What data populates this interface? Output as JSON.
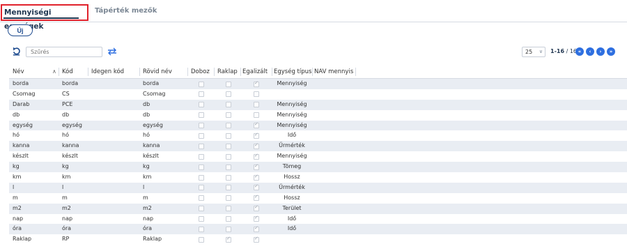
{
  "tabs": [
    {
      "label": "Mennyiségi egységek",
      "active": true
    },
    {
      "label": "Tápérték mezők",
      "active": false
    }
  ],
  "new_button": "Új",
  "filter": {
    "placeholder": "Szűrés",
    "value": "Szűrés"
  },
  "pagination": {
    "page_size": "25",
    "range": "1-16",
    "total": " / 16"
  },
  "icons": {
    "refresh": "refresh-icon",
    "swap": "swap-columns-icon",
    "first": "first-page-icon",
    "prev": "prev-page-icon",
    "next": "next-page-icon",
    "last": "last-page-icon"
  },
  "colors": {
    "accent": "#2e6fe0",
    "tab_highlight": "#e0212b",
    "row_stripe": "#e9edf3"
  },
  "columns": [
    "Név",
    "Kód",
    "Idegen kód",
    "Rövid név",
    "Doboz",
    "Raklap",
    "Egalizált",
    "Egység típus",
    "NAV mennyis"
  ],
  "rows": [
    {
      "nev": "borda",
      "kod": "borda",
      "idegen": "",
      "rovid": "borda",
      "doboz": false,
      "raklap": false,
      "egal": true,
      "tipus": "Mennyiség"
    },
    {
      "nev": "Csomag",
      "kod": "CS",
      "idegen": "",
      "rovid": "Csomag",
      "doboz": false,
      "raklap": false,
      "egal": false,
      "tipus": ""
    },
    {
      "nev": "Darab",
      "kod": "PCE",
      "idegen": "",
      "rovid": "db",
      "doboz": false,
      "raklap": false,
      "egal": false,
      "tipus": "Mennyiség"
    },
    {
      "nev": "db",
      "kod": "db",
      "idegen": "",
      "rovid": "db",
      "doboz": false,
      "raklap": false,
      "egal": false,
      "tipus": "Mennyiség"
    },
    {
      "nev": "egység",
      "kod": "egység",
      "idegen": "",
      "rovid": "egység",
      "doboz": false,
      "raklap": false,
      "egal": true,
      "tipus": "Mennyiség"
    },
    {
      "nev": "hó",
      "kod": "hó",
      "idegen": "",
      "rovid": "hó",
      "doboz": false,
      "raklap": false,
      "egal": true,
      "tipus": "Idő"
    },
    {
      "nev": "kanna",
      "kod": "kanna",
      "idegen": "",
      "rovid": "kanna",
      "doboz": false,
      "raklap": false,
      "egal": true,
      "tipus": "Űrmérték"
    },
    {
      "nev": "készlt",
      "kod": "készlt",
      "idegen": "",
      "rovid": "készlt",
      "doboz": false,
      "raklap": false,
      "egal": true,
      "tipus": "Mennyiség"
    },
    {
      "nev": "kg",
      "kod": "kg",
      "idegen": "",
      "rovid": "kg",
      "doboz": false,
      "raklap": false,
      "egal": true,
      "tipus": "Tömeg"
    },
    {
      "nev": "km",
      "kod": "km",
      "idegen": "",
      "rovid": "km",
      "doboz": false,
      "raklap": false,
      "egal": true,
      "tipus": "Hossz"
    },
    {
      "nev": "l",
      "kod": "l",
      "idegen": "",
      "rovid": "l",
      "doboz": false,
      "raklap": false,
      "egal": true,
      "tipus": "Űrmérték"
    },
    {
      "nev": "m",
      "kod": "m",
      "idegen": "",
      "rovid": "m",
      "doboz": false,
      "raklap": false,
      "egal": true,
      "tipus": "Hossz"
    },
    {
      "nev": "m2",
      "kod": "m2",
      "idegen": "",
      "rovid": "m2",
      "doboz": false,
      "raklap": false,
      "egal": true,
      "tipus": "Terület"
    },
    {
      "nev": "nap",
      "kod": "nap",
      "idegen": "",
      "rovid": "nap",
      "doboz": false,
      "raklap": false,
      "egal": true,
      "tipus": "Idő"
    },
    {
      "nev": "óra",
      "kod": "óra",
      "idegen": "",
      "rovid": "óra",
      "doboz": false,
      "raklap": false,
      "egal": true,
      "tipus": "Idő"
    },
    {
      "nev": "Raklap",
      "kod": "RP",
      "idegen": "",
      "rovid": "Raklap",
      "doboz": false,
      "raklap": true,
      "egal": true,
      "tipus": ""
    }
  ]
}
